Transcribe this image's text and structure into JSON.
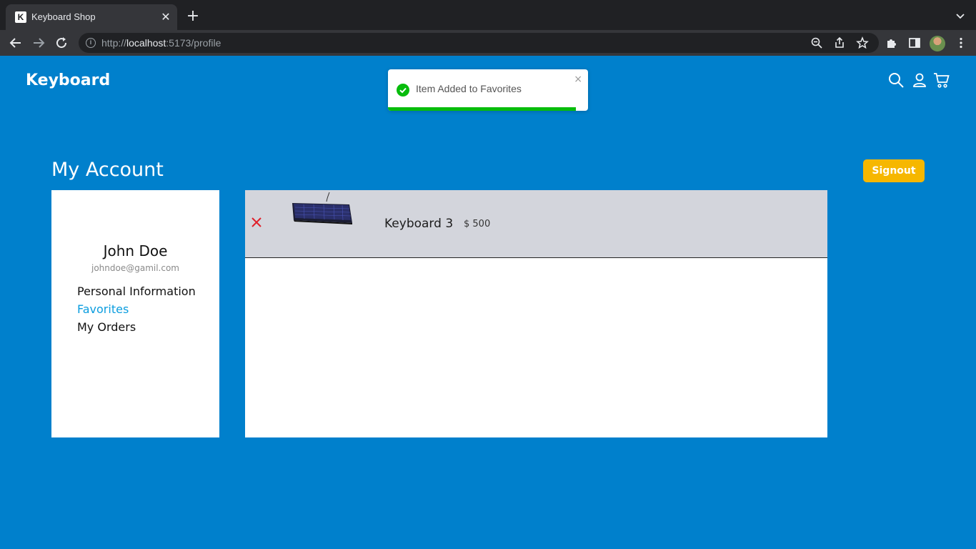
{
  "browser": {
    "tab_title": "Keyboard Shop",
    "tab_favicon_letter": "K",
    "tab_close": "✕",
    "new_tab": "+",
    "url_scheme": "http://",
    "url_host": "localhost",
    "url_path": ":5173/profile",
    "info_letter": "i"
  },
  "header": {
    "logo": "Keyboard"
  },
  "toast": {
    "message": "Item Added to Favorites",
    "close": "×",
    "progress": 0.94,
    "accent_color": "#07bc0c"
  },
  "account": {
    "title": "My Account",
    "signout_label": "Signout"
  },
  "user": {
    "name": "John Doe",
    "email": "johndoe@gamil.com"
  },
  "sidebar": {
    "items": [
      {
        "label": "Personal Information",
        "active": false
      },
      {
        "label": "Favorites",
        "active": true
      },
      {
        "label": "My Orders",
        "active": false
      }
    ]
  },
  "favorites": [
    {
      "name": "Keyboard 3",
      "price": "$ 500"
    }
  ],
  "colors": {
    "page_bg": "#0080cc",
    "signout_bg": "#f6b700",
    "active_link": "#0b9ddf",
    "remove": "#e0202a"
  }
}
